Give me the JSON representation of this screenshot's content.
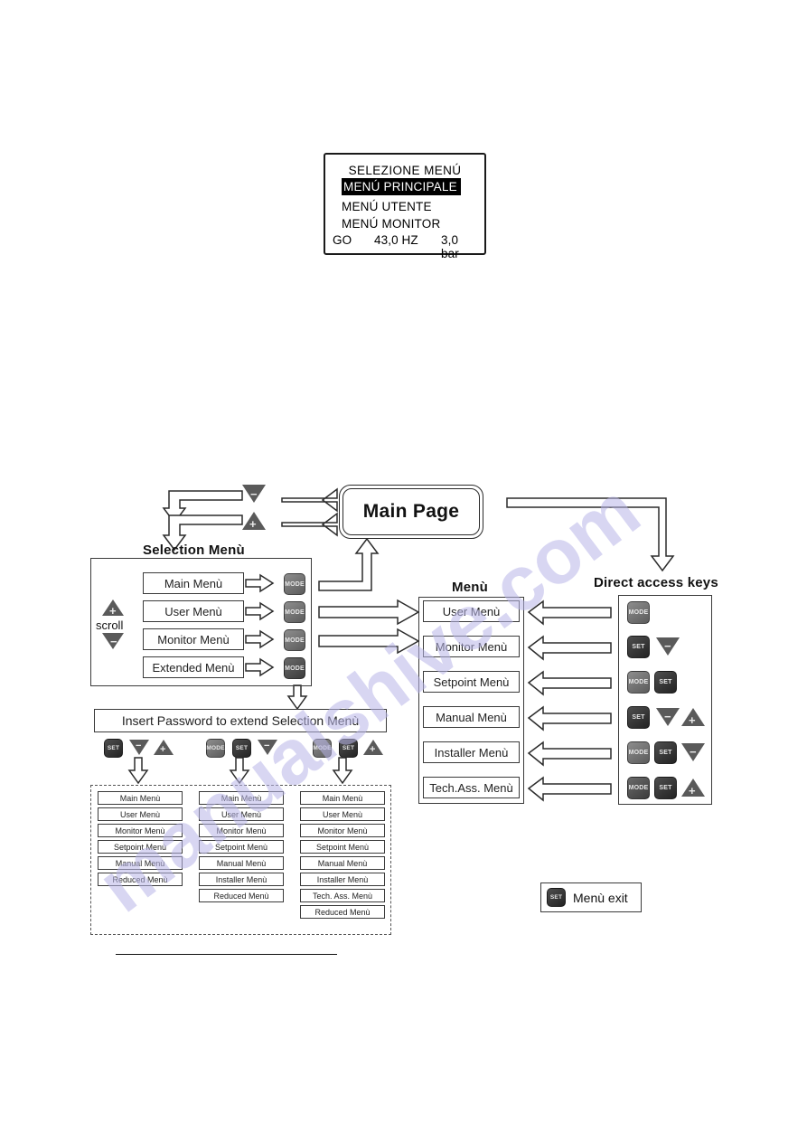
{
  "lcd": {
    "title": "SELEZIONE MENÚ",
    "selected_row": "MENÚ PRINCIPALE",
    "rows": [
      "MENÚ UTENTE",
      "MENÚ MONITOR"
    ],
    "status": {
      "mode": "GO",
      "frequency": "43,0 HZ",
      "pressure": "3,0  bar"
    }
  },
  "diagram": {
    "main_page": "Main Page",
    "selection_menu_caption": "Selection Menù",
    "menu_caption": "Menù",
    "direct_access_caption": "Direct access keys",
    "scroll_label": "scroll",
    "password_bar": "Insert Password to extend Selection Menù",
    "exit": {
      "key": "SET",
      "label": "Menù exit"
    }
  },
  "selection_menu": {
    "items": [
      {
        "label": "Main Menù",
        "key": "MODE"
      },
      {
        "label": "User Menù",
        "key": "MODE"
      },
      {
        "label": "Monitor Menù",
        "key": "MODE"
      },
      {
        "label": "Extended Menù",
        "key": "MODE"
      }
    ]
  },
  "menu_column": {
    "items": [
      "User Menù",
      "Monitor Menù",
      "Setpoint Menù",
      "Manual Menù",
      "Installer Menù",
      "Tech.Ass. Menù"
    ]
  },
  "direct_access_keys": {
    "rows": [
      [
        "MODE"
      ],
      [
        "SET",
        "minus"
      ],
      [
        "MODE",
        "SET"
      ],
      [
        "SET",
        "minus",
        "plus"
      ],
      [
        "MODE",
        "SET",
        "minus"
      ],
      [
        "MODE",
        "SET",
        "plus"
      ]
    ]
  },
  "password_groups": [
    {
      "keys": [
        "SET",
        "minus",
        "plus"
      ]
    },
    {
      "keys": [
        "MODE",
        "SET",
        "minus"
      ]
    },
    {
      "keys": [
        "MODE",
        "SET",
        "plus"
      ]
    }
  ],
  "password_results": [
    {
      "items": [
        "Main Menù",
        "User Menù",
        "Monitor Menù",
        "Setpoint Menù",
        "Manual Menù",
        "Reduced Menù"
      ]
    },
    {
      "items": [
        "Main Menù",
        "User Menù",
        "Monitor Menù",
        "Setpoint Menù",
        "Manual Menù",
        "Installer Menù",
        "Reduced Menù"
      ]
    },
    {
      "items": [
        "Main Menù",
        "User Menù",
        "Monitor Menù",
        "Setpoint Menù",
        "Manual Menù",
        "Installer Menù",
        "Tech. Ass. Menù",
        "Reduced Menù"
      ]
    }
  ],
  "watermark": {
    "text": "manualshive.com"
  },
  "colors": {
    "key_mode": "#6e6e6e",
    "key_set": "#343434",
    "triangle": "#5a5a5a",
    "outline": "#2b2b2b"
  }
}
